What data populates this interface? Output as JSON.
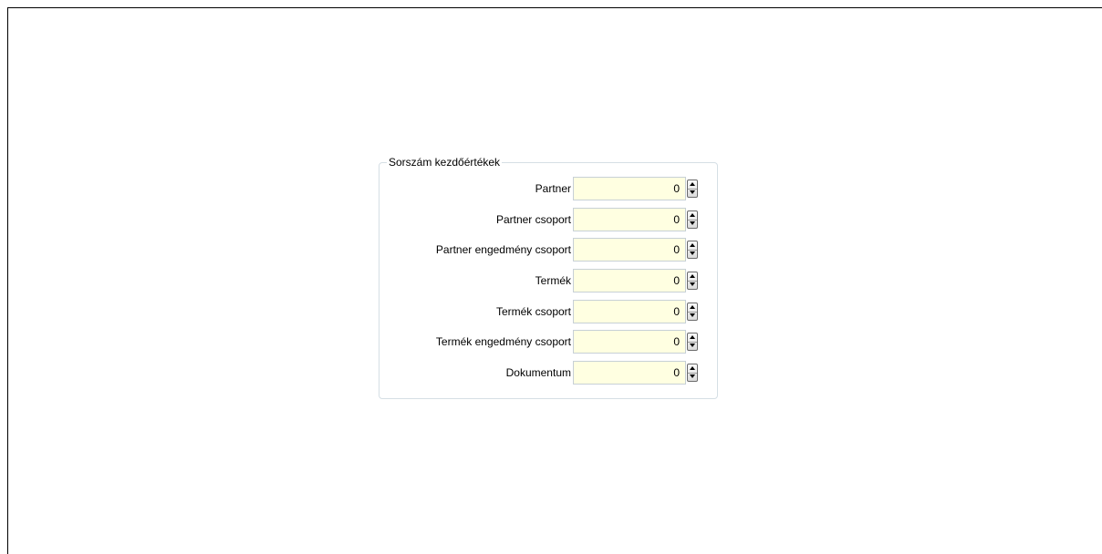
{
  "group": {
    "title": "Sorszám kezdőértékek",
    "fields": [
      {
        "label": "Partner",
        "value": "0"
      },
      {
        "label": "Partner csoport",
        "value": "0"
      },
      {
        "label": "Partner engedmény csoport",
        "value": "0"
      },
      {
        "label": "Termék",
        "value": "0"
      },
      {
        "label": "Termék csoport",
        "value": "0"
      },
      {
        "label": "Termék engedmény csoport",
        "value": "0"
      },
      {
        "label": "Dokumentum",
        "value": "0"
      }
    ]
  },
  "colors": {
    "field_background": "#ffffe1",
    "group_border": "#d5dfe5"
  }
}
